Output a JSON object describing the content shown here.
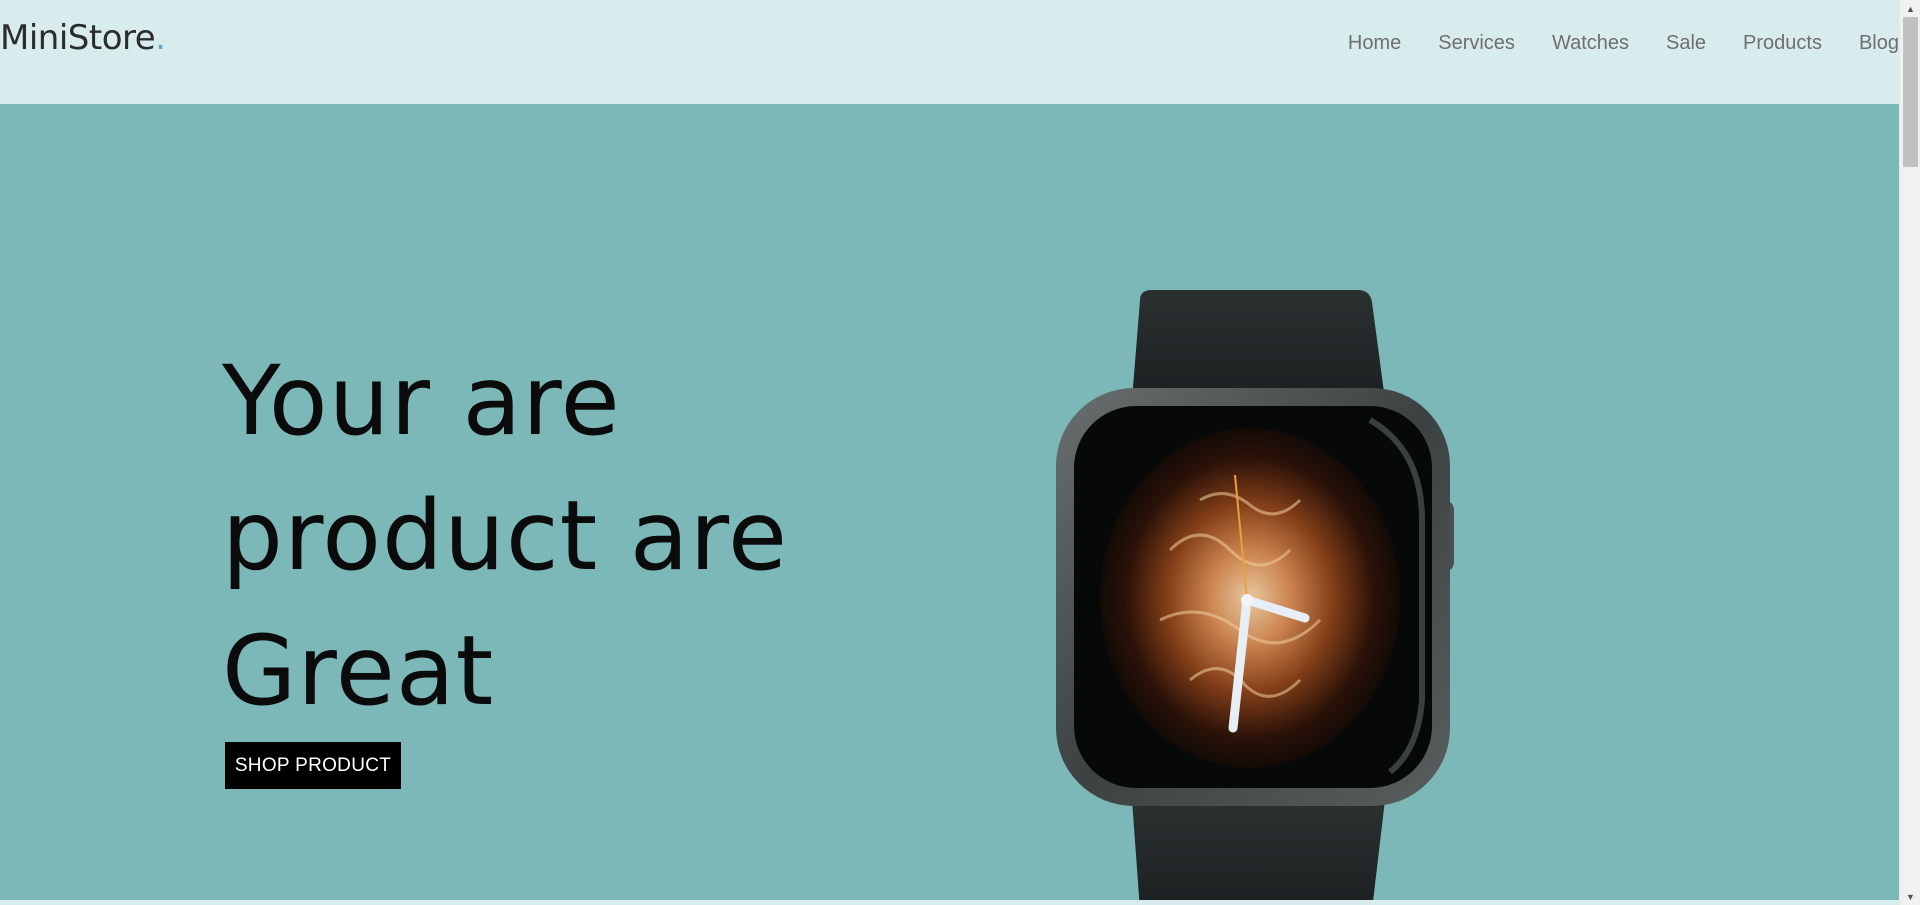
{
  "header": {
    "logo_text": "MiniStore",
    "logo_dot": ".",
    "nav": [
      "Home",
      "Services",
      "Watches",
      "Sale",
      "Products",
      "Blog"
    ]
  },
  "hero": {
    "headline_lines": [
      "Your are",
      "product are",
      "Great"
    ],
    "cta_label": "SHOP PRODUCT",
    "product_image": "smartwatch-image"
  },
  "colors": {
    "header_bg": "#d8ecee",
    "hero_bg": "#7db8b8",
    "cta_bg": "#000000",
    "logo_dot": "#6aa7c7"
  },
  "icons": [
    "arrow-up-icon",
    "arrow-down-icon"
  ]
}
